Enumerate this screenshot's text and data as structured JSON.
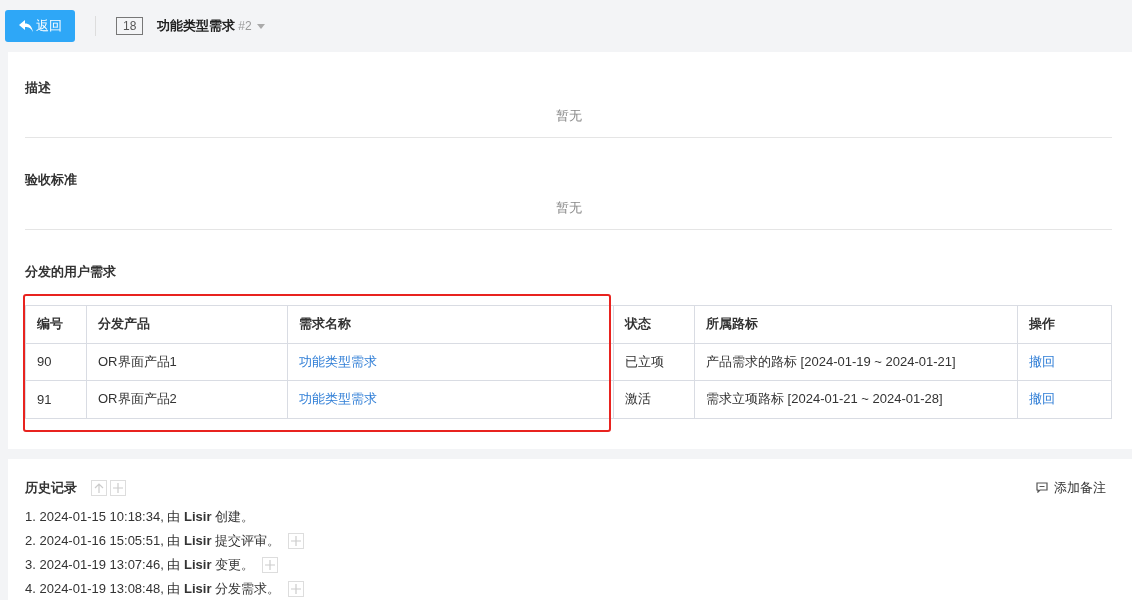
{
  "header": {
    "back_button": "返回",
    "id_badge": "18",
    "title": "功能类型需求",
    "version": "#2"
  },
  "sections": [
    {
      "title": "描述",
      "content": "暂无"
    },
    {
      "title": "验收标准",
      "content": "暂无"
    }
  ],
  "distribution": {
    "title": "分发的用户需求",
    "highlighted": true,
    "columns": [
      "编号",
      "分发产品",
      "需求名称",
      "状态",
      "所属路标",
      "操作"
    ],
    "rows": [
      {
        "id": "90",
        "product": "OR界面产品1",
        "name": "功能类型需求",
        "status": "已立项",
        "milestone": "产品需求的路标 [2024-01-19 ~ 2024-01-21]",
        "action": "撤回"
      },
      {
        "id": "91",
        "product": "OR界面产品2",
        "name": "功能类型需求",
        "status": "激活",
        "milestone": "需求立项路标 [2024-01-21 ~ 2024-01-28]",
        "action": "撤回"
      }
    ]
  },
  "history": {
    "title": "历史记录",
    "add_note": "添加备注",
    "entries": [
      {
        "text": "1. 2024-01-15 10:18:34, 由 **Lisir** 创建。",
        "expandable": false
      },
      {
        "text": "2. 2024-01-16 15:05:51, 由 **Lisir** 提交评审。",
        "expandable": true
      },
      {
        "text": "3. 2024-01-19 13:07:46, 由 **Lisir** 变更。",
        "expandable": true
      },
      {
        "text": "4. 2024-01-19 13:08:48, 由 **Lisir** 分发需求。",
        "expandable": true
      }
    ]
  }
}
